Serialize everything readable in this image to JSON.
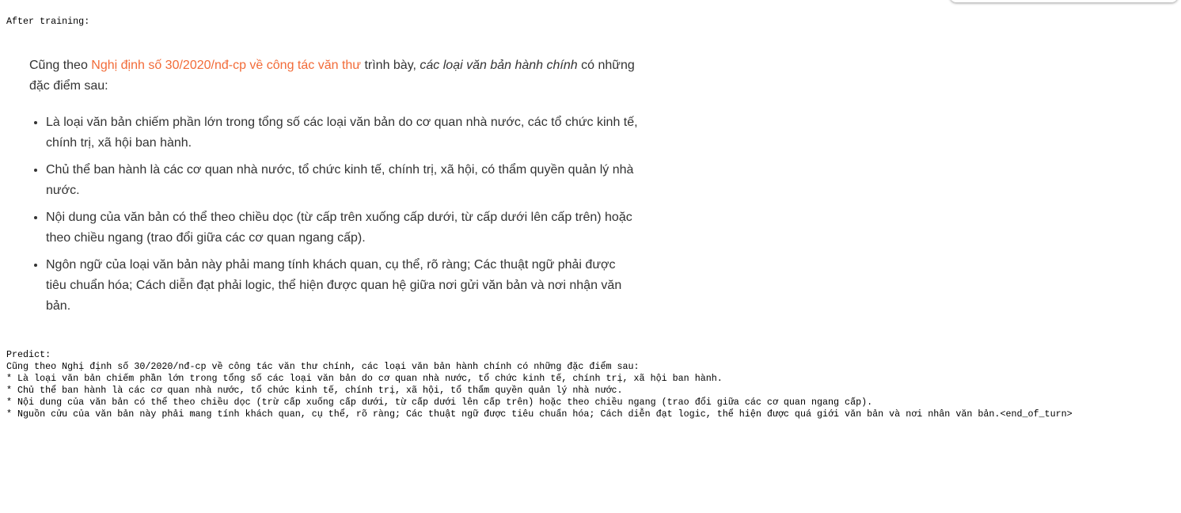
{
  "after_label": "After training:",
  "answer": {
    "intro_prefix": "Cũng theo ",
    "intro_link": "Nghị định số 30/2020/nđ-cp về công tác văn thư",
    "intro_middle": " trình bày, ",
    "intro_italic": "các loại văn bản hành chính",
    "intro_suffix": " có những đặc điểm sau:",
    "items": [
      "Là loại văn bản chiếm phần lớn trong tổng số các loại văn bản do cơ quan nhà nước, các tổ chức kinh tế, chính trị, xã hội ban hành.",
      "Chủ thể ban hành là các cơ quan nhà nước, tổ chức kinh tế, chính trị, xã hội, có thẩm quyền quản lý nhà nước.",
      "Nội dung của văn bản có thể theo chiều dọc (từ cấp trên xuống cấp dưới, từ cấp dưới lên cấp trên) hoặc theo chiều ngang (trao đổi giữa các cơ quan ngang cấp).",
      "Ngôn ngữ của loại văn bản này phải mang tính khách quan, cụ thể, rõ ràng; Các thuật ngữ phải được tiêu chuẩn hóa; Cách diễn đạt phải logic, thể hiện được quan hệ giữa nơi gửi văn bản và nơi nhận văn bản."
    ]
  },
  "predict": {
    "label": "Predict:",
    "lines": [
      "Cũng theo Nghị định số 30/2020/nđ-cp về công tác văn thư chính, các loại văn bản hành chính có những đặc điểm sau:",
      "* Là loại văn bản chiếm phần lớn trong tổng số các loại văn bản do cơ quan nhà nước, tổ chức kinh tế, chính trị, xã hội ban hành.",
      "* Chủ thể ban hành là các cơ quan nhà nước, tổ chức kinh tế, chính trị, xã hội, tổ thẩm quyền quản lý nhà nước.",
      "* Nội dung của văn bản có thể theo chiều dọc (trừ cấp xuống cấp dưới, từ cấp dưới lên cấp trên) hoặc theo chiều ngang (trao đổi giữa các cơ quan ngang cấp).",
      "* Nguồn cửu của văn bản này phải mang tính khách quan, cụ thể, rõ ràng; Các thuật ngữ được tiêu chuẩn hóa; Cách diễn đạt logic, thể hiện được quá giới văn bản và nơi nhân văn bản.<end_of_turn>"
    ]
  }
}
